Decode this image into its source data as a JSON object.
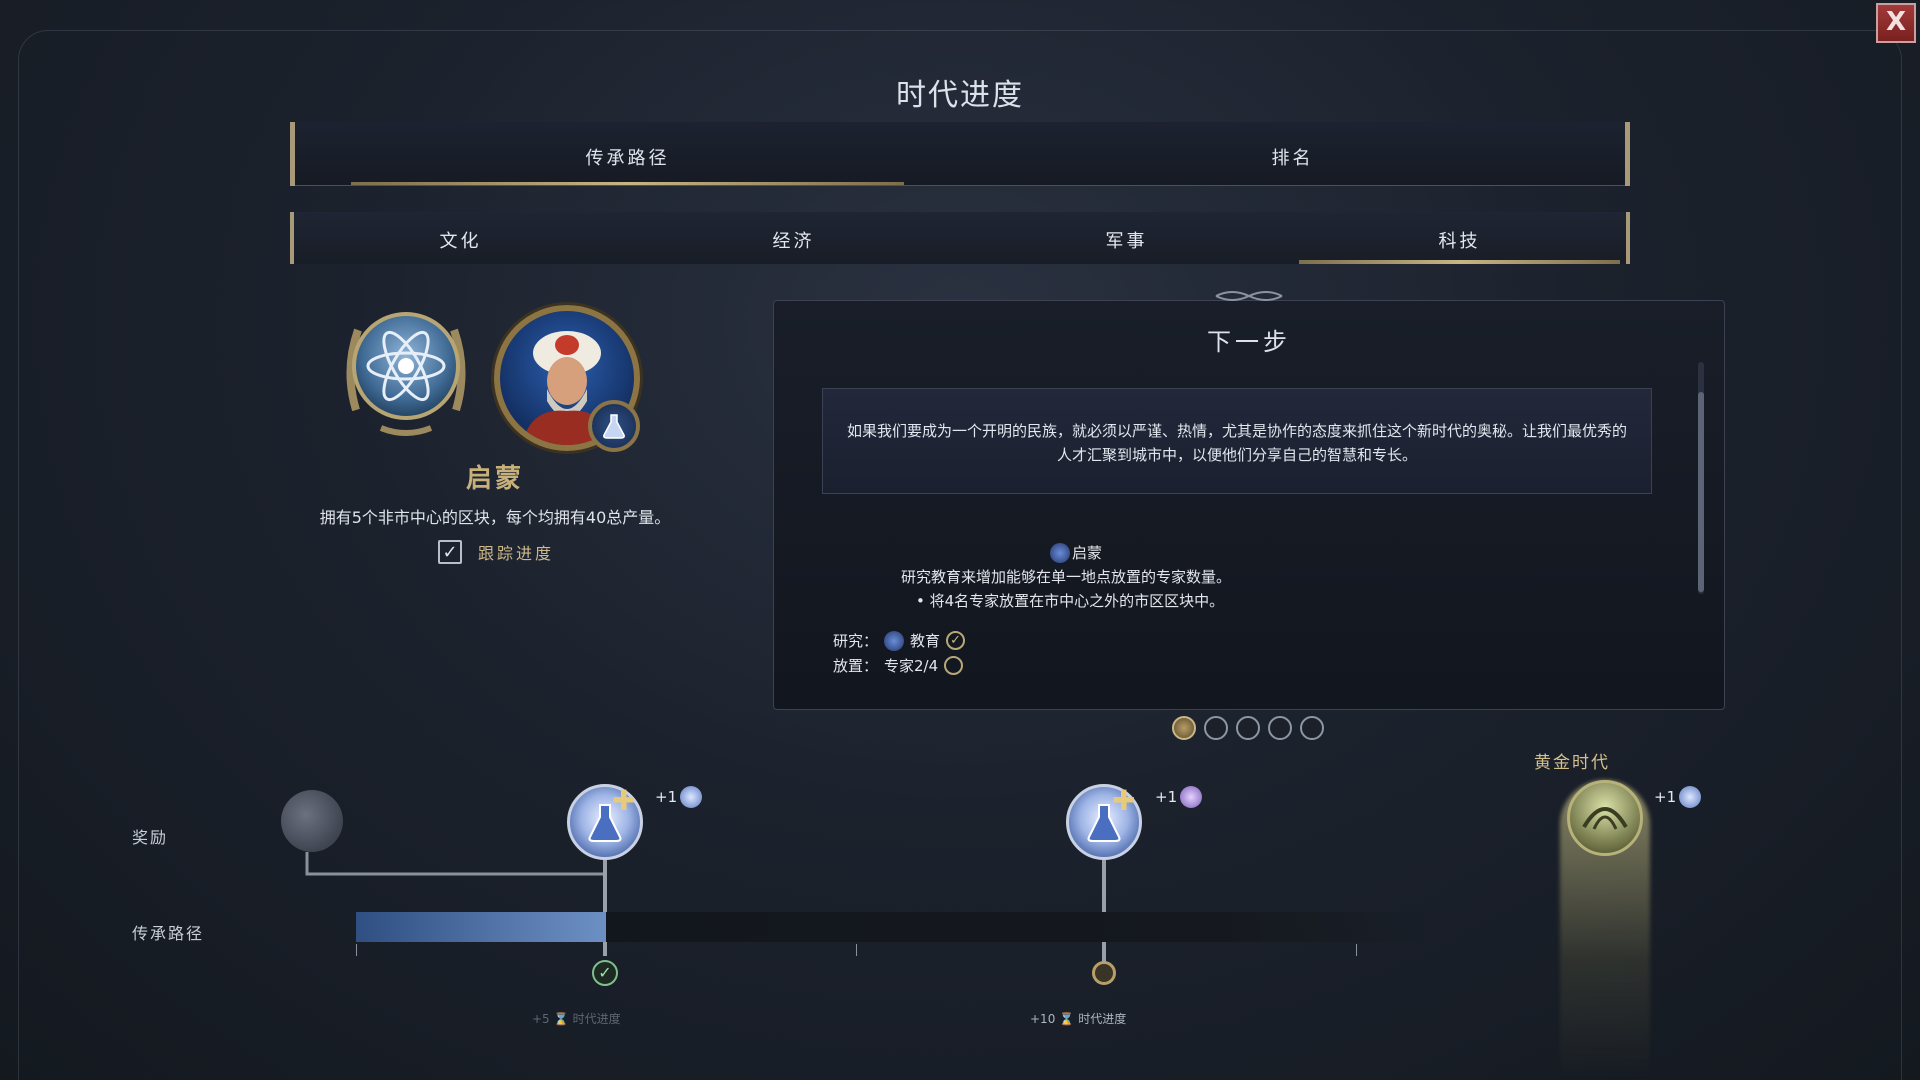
{
  "window": {
    "title": "时代进度",
    "close_label": "X"
  },
  "main_tabs": [
    {
      "label": "传承路径",
      "active": true
    },
    {
      "label": "排名",
      "active": false
    }
  ],
  "sub_tabs": [
    {
      "label": "文化",
      "active": false
    },
    {
      "label": "经济",
      "active": false
    },
    {
      "label": "军事",
      "active": false
    },
    {
      "label": "科技",
      "active": true
    }
  ],
  "goal": {
    "title": "启蒙",
    "description": "拥有5个非市中心的区块，每个均拥有40总产量。",
    "track_label": "跟踪进度",
    "track_checked": true,
    "icons": [
      "science-atom-medal-icon",
      "advisor-portrait",
      "science-flask-icon"
    ]
  },
  "next_step": {
    "title": "下一步",
    "quote": "如果我们要成为一个开明的民族，就必须以严谨、热情，尤其是协作的态度来抓住这个新时代的奥秘。让我们最优秀的人才汇聚到城市中，以便他们分享自己的智慧和专长。",
    "goal_name": "启蒙",
    "goal_line1": "研究教育来增加能够在单一地点放置的专家数量。",
    "goal_line2": "• 将4名专家放置在市中心之外的市区区块中。",
    "requirements": [
      {
        "label": "研究：",
        "value": "教育",
        "done": true
      },
      {
        "label": "放置：",
        "value": "专家2/4",
        "done": false
      }
    ]
  },
  "pager": {
    "count": 5,
    "active_index": 0
  },
  "progress": {
    "rewards_label": "奖励",
    "path_label": "传承路径",
    "fraction": 0.23,
    "golden_age_label": "黄金时代",
    "milestones": [
      {
        "bonus": "+1",
        "bonus_icon": "science-icon",
        "reward_label": "+5",
        "reward_suffix": "时代进度",
        "reached": true
      },
      {
        "bonus": "+1",
        "bonus_icon": "culture-icon",
        "reward_label": "+10",
        "reward_suffix": "时代进度",
        "reached": false
      }
    ],
    "golden_bonus": "+1"
  },
  "colors": {
    "accent_gold": "#c8b584",
    "progress_blue": "#6d90c4",
    "background": "#1c222d"
  }
}
